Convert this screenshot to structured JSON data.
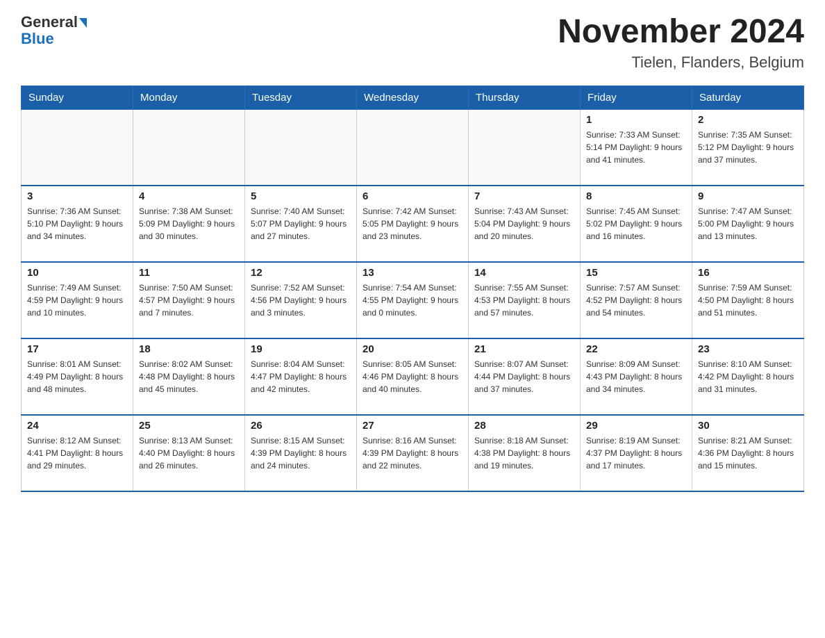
{
  "header": {
    "logo_general": "General",
    "logo_blue": "Blue",
    "month_title": "November 2024",
    "location": "Tielen, Flanders, Belgium"
  },
  "weekdays": [
    "Sunday",
    "Monday",
    "Tuesday",
    "Wednesday",
    "Thursday",
    "Friday",
    "Saturday"
  ],
  "weeks": [
    [
      {
        "day": "",
        "info": ""
      },
      {
        "day": "",
        "info": ""
      },
      {
        "day": "",
        "info": ""
      },
      {
        "day": "",
        "info": ""
      },
      {
        "day": "",
        "info": ""
      },
      {
        "day": "1",
        "info": "Sunrise: 7:33 AM\nSunset: 5:14 PM\nDaylight: 9 hours and 41 minutes."
      },
      {
        "day": "2",
        "info": "Sunrise: 7:35 AM\nSunset: 5:12 PM\nDaylight: 9 hours and 37 minutes."
      }
    ],
    [
      {
        "day": "3",
        "info": "Sunrise: 7:36 AM\nSunset: 5:10 PM\nDaylight: 9 hours and 34 minutes."
      },
      {
        "day": "4",
        "info": "Sunrise: 7:38 AM\nSunset: 5:09 PM\nDaylight: 9 hours and 30 minutes."
      },
      {
        "day": "5",
        "info": "Sunrise: 7:40 AM\nSunset: 5:07 PM\nDaylight: 9 hours and 27 minutes."
      },
      {
        "day": "6",
        "info": "Sunrise: 7:42 AM\nSunset: 5:05 PM\nDaylight: 9 hours and 23 minutes."
      },
      {
        "day": "7",
        "info": "Sunrise: 7:43 AM\nSunset: 5:04 PM\nDaylight: 9 hours and 20 minutes."
      },
      {
        "day": "8",
        "info": "Sunrise: 7:45 AM\nSunset: 5:02 PM\nDaylight: 9 hours and 16 minutes."
      },
      {
        "day": "9",
        "info": "Sunrise: 7:47 AM\nSunset: 5:00 PM\nDaylight: 9 hours and 13 minutes."
      }
    ],
    [
      {
        "day": "10",
        "info": "Sunrise: 7:49 AM\nSunset: 4:59 PM\nDaylight: 9 hours and 10 minutes."
      },
      {
        "day": "11",
        "info": "Sunrise: 7:50 AM\nSunset: 4:57 PM\nDaylight: 9 hours and 7 minutes."
      },
      {
        "day": "12",
        "info": "Sunrise: 7:52 AM\nSunset: 4:56 PM\nDaylight: 9 hours and 3 minutes."
      },
      {
        "day": "13",
        "info": "Sunrise: 7:54 AM\nSunset: 4:55 PM\nDaylight: 9 hours and 0 minutes."
      },
      {
        "day": "14",
        "info": "Sunrise: 7:55 AM\nSunset: 4:53 PM\nDaylight: 8 hours and 57 minutes."
      },
      {
        "day": "15",
        "info": "Sunrise: 7:57 AM\nSunset: 4:52 PM\nDaylight: 8 hours and 54 minutes."
      },
      {
        "day": "16",
        "info": "Sunrise: 7:59 AM\nSunset: 4:50 PM\nDaylight: 8 hours and 51 minutes."
      }
    ],
    [
      {
        "day": "17",
        "info": "Sunrise: 8:01 AM\nSunset: 4:49 PM\nDaylight: 8 hours and 48 minutes."
      },
      {
        "day": "18",
        "info": "Sunrise: 8:02 AM\nSunset: 4:48 PM\nDaylight: 8 hours and 45 minutes."
      },
      {
        "day": "19",
        "info": "Sunrise: 8:04 AM\nSunset: 4:47 PM\nDaylight: 8 hours and 42 minutes."
      },
      {
        "day": "20",
        "info": "Sunrise: 8:05 AM\nSunset: 4:46 PM\nDaylight: 8 hours and 40 minutes."
      },
      {
        "day": "21",
        "info": "Sunrise: 8:07 AM\nSunset: 4:44 PM\nDaylight: 8 hours and 37 minutes."
      },
      {
        "day": "22",
        "info": "Sunrise: 8:09 AM\nSunset: 4:43 PM\nDaylight: 8 hours and 34 minutes."
      },
      {
        "day": "23",
        "info": "Sunrise: 8:10 AM\nSunset: 4:42 PM\nDaylight: 8 hours and 31 minutes."
      }
    ],
    [
      {
        "day": "24",
        "info": "Sunrise: 8:12 AM\nSunset: 4:41 PM\nDaylight: 8 hours and 29 minutes."
      },
      {
        "day": "25",
        "info": "Sunrise: 8:13 AM\nSunset: 4:40 PM\nDaylight: 8 hours and 26 minutes."
      },
      {
        "day": "26",
        "info": "Sunrise: 8:15 AM\nSunset: 4:39 PM\nDaylight: 8 hours and 24 minutes."
      },
      {
        "day": "27",
        "info": "Sunrise: 8:16 AM\nSunset: 4:39 PM\nDaylight: 8 hours and 22 minutes."
      },
      {
        "day": "28",
        "info": "Sunrise: 8:18 AM\nSunset: 4:38 PM\nDaylight: 8 hours and 19 minutes."
      },
      {
        "day": "29",
        "info": "Sunrise: 8:19 AM\nSunset: 4:37 PM\nDaylight: 8 hours and 17 minutes."
      },
      {
        "day": "30",
        "info": "Sunrise: 8:21 AM\nSunset: 4:36 PM\nDaylight: 8 hours and 15 minutes."
      }
    ]
  ]
}
